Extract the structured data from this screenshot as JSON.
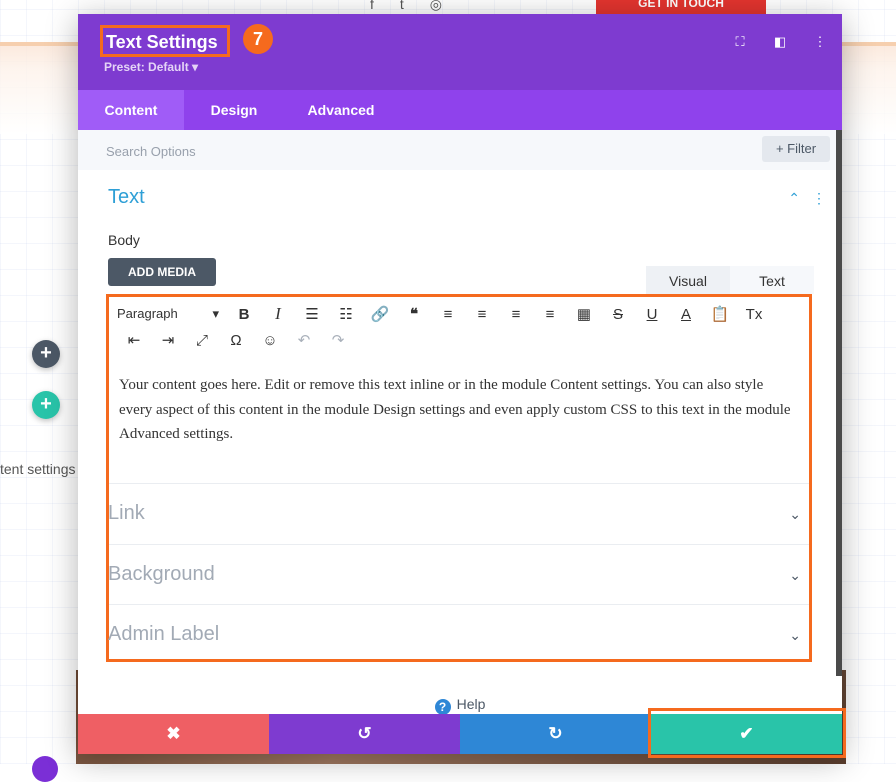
{
  "background": {
    "cta_label": "GET IN TOUCH",
    "social_icons": [
      "facebook-icon",
      "twitter-icon",
      "instagram-icon"
    ],
    "add_row_symbol": "+",
    "add_module_symbol": "+",
    "content_fragment": "tent settings"
  },
  "modal": {
    "title": "Text Settings",
    "step_number": "7",
    "preset": "Preset: Default ▾",
    "header_icons": [
      "expand-icon",
      "split-view-icon",
      "more-options-icon"
    ],
    "tabs": [
      {
        "label": "Content"
      },
      {
        "label": "Design"
      },
      {
        "label": "Advanced"
      }
    ],
    "search_placeholder": "Search Options",
    "filter_label": "+ Filter"
  },
  "text_section": {
    "title": "Text",
    "body_label": "Body",
    "add_media_label": "ADD MEDIA",
    "editor_tabs": [
      "Visual",
      "Text"
    ],
    "format_select": "Paragraph",
    "body_text": "Your content goes here. Edit or remove this text inline or in the module Content settings. You can also style every aspect of this content in the module Design settings and even apply custom CSS to this text in the module Advanced settings."
  },
  "toolbar_glyphs": {
    "bold": "B",
    "italic": "I",
    "bullets": "☰",
    "numbers": "☷",
    "link": "🔗",
    "quote": "❝",
    "align_left": "≡",
    "align_center": "≡",
    "align_right": "≡",
    "justify": "≡",
    "table": "▦",
    "strike": "S",
    "underline": "U",
    "text_color": "A",
    "paste": "📋",
    "clear": "Tx",
    "outdent": "⇤",
    "indent": "⇥",
    "fullscreen": "⤢",
    "omega": "Ω",
    "emoji": "☺",
    "undo": "↶",
    "redo": "↷"
  },
  "sections": [
    {
      "label": "Link"
    },
    {
      "label": "Background"
    },
    {
      "label": "Admin Label"
    }
  ],
  "help_label": "Help",
  "footer": {
    "discard": "✖",
    "undo": "↺",
    "redo": "↻",
    "save": "✔"
  },
  "colors": {
    "header": "#7e3bd0",
    "tabs": "#8f42ec",
    "accent_blue": "#2e9fd6",
    "highlight": "#f56a1e",
    "discard": "#ef5f64",
    "redo": "#2e87d6",
    "save": "#29c4a9"
  }
}
